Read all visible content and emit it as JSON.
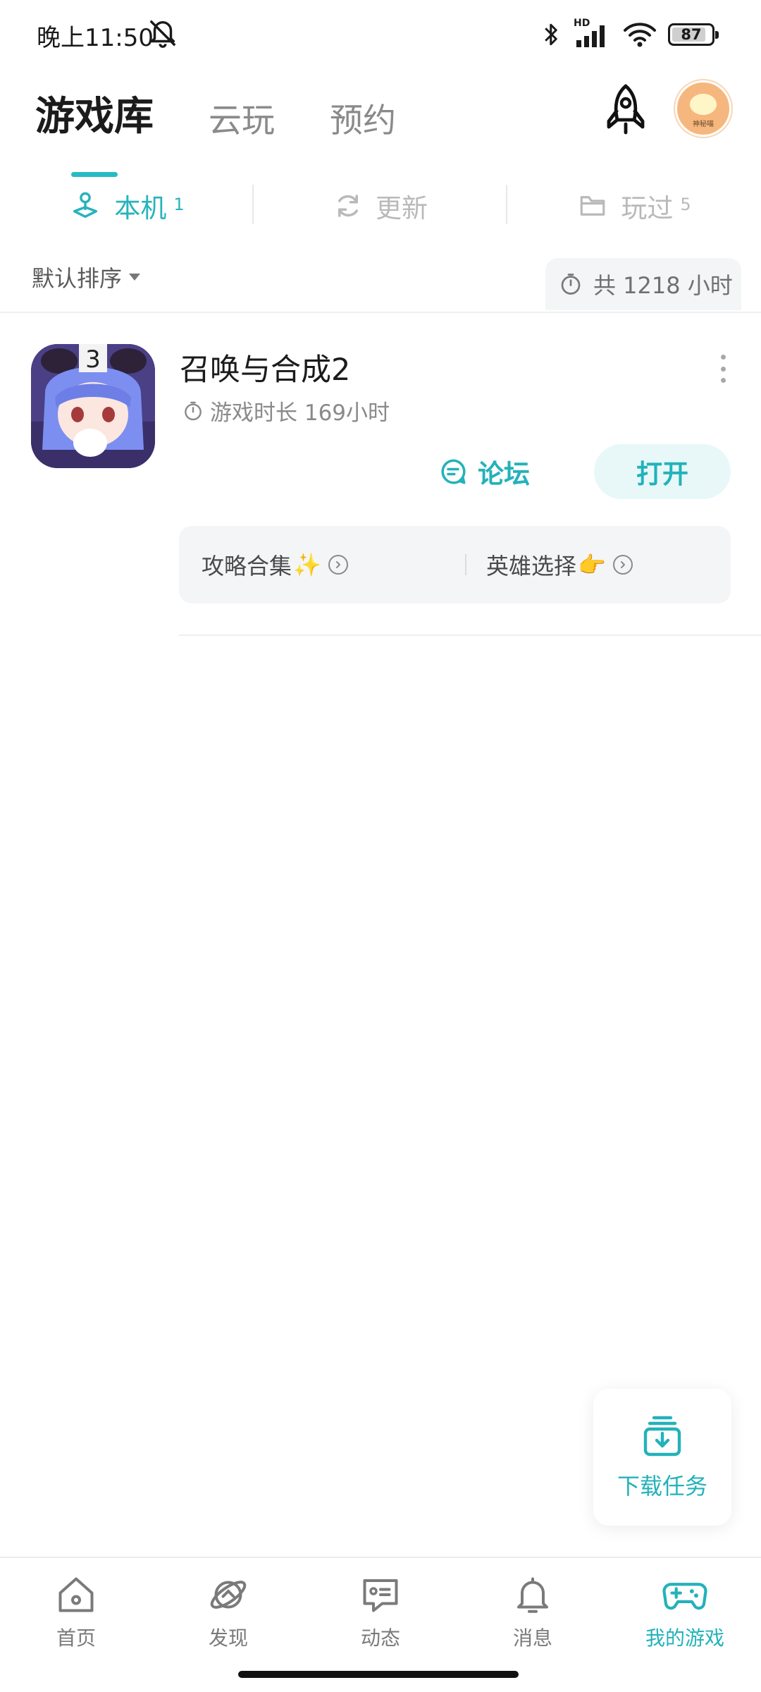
{
  "status_bar": {
    "time": "晚上11:50",
    "network_label": "HD",
    "battery": "87",
    "battery_level": 0.87
  },
  "top_tabs": [
    {
      "label": "游戏库",
      "active": true
    },
    {
      "label": "云玩",
      "active": false
    },
    {
      "label": "预约",
      "active": false
    }
  ],
  "header_icons": {
    "rocket": "rocket-icon",
    "avatar_text": "神秘喵"
  },
  "sub_tabs": [
    {
      "label": "本机",
      "count": "1",
      "icon": "joystick-icon",
      "active": true
    },
    {
      "label": "更新",
      "count": "",
      "icon": "refresh-icon",
      "active": false
    },
    {
      "label": "玩过",
      "count": "5",
      "icon": "folder-icon",
      "active": false
    }
  ],
  "sort": {
    "label": "默认排序"
  },
  "total_time": {
    "label": "共 1218 小时"
  },
  "game": {
    "title": "召唤与合成2",
    "play_time": "游戏时长 169小时",
    "forum_label": "论坛",
    "open_label": "打开",
    "icon_badge": "3",
    "guides": [
      {
        "label": "攻略合集",
        "emoji": "✨"
      },
      {
        "label": "英雄选择",
        "emoji": "👉"
      }
    ]
  },
  "download_fab": {
    "label": "下载任务"
  },
  "bottom_nav": [
    {
      "label": "首页",
      "icon": "home-icon",
      "active": false
    },
    {
      "label": "发现",
      "icon": "planet-icon",
      "active": false
    },
    {
      "label": "动态",
      "icon": "chat-icon",
      "active": false
    },
    {
      "label": "消息",
      "icon": "bell-icon",
      "active": false
    },
    {
      "label": "我的游戏",
      "icon": "gamepad-icon",
      "active": true
    }
  ],
  "colors": {
    "accent": "#27b3bb",
    "muted": "#b9b9b9",
    "text": "#1b1b1b"
  }
}
